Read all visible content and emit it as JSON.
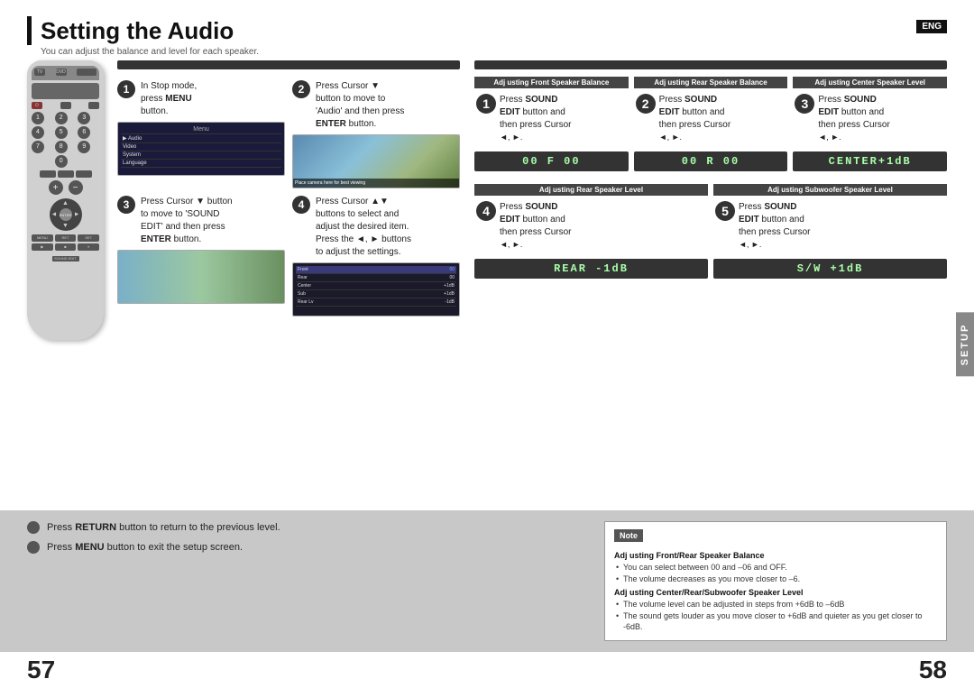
{
  "page": {
    "title": "Setting the Audio",
    "title_bar": "|",
    "subtitle": "You can adjust the balance and level for each speaker.",
    "eng_badge": "ENG",
    "page_num_left": "57",
    "page_num_right": "58",
    "setup_tab": "SETUP"
  },
  "left_steps": {
    "bar_label": "",
    "step1": {
      "num": "1",
      "text_line1": "In Stop mode,",
      "text_line2": "press ",
      "text_bold": "MENU",
      "text_line3": "button."
    },
    "step2": {
      "num": "2",
      "text_line1": "Press Cursor ▼",
      "text_line2": "button to move to",
      "text_line3": "'Audio' and then press",
      "text_bold": "ENTER",
      "text_line4": " button."
    },
    "step3": {
      "num": "3",
      "text_line1": "Press Cursor ▼ button",
      "text_line2": "to move to 'SOUND",
      "text_line3": "EDIT' and then press",
      "text_bold": "ENTER",
      "text_line4": " button."
    },
    "step4": {
      "num": "4",
      "text_line1": "Press Cursor ▲▼",
      "text_line2": "buttons to select and",
      "text_line3": "adjust the desired item.",
      "text_line4": "Press the ◄, ► buttons",
      "text_line5": "to adjust the settings."
    }
  },
  "right_sections": {
    "section1": {
      "label": "Adj usting Front Speaker Balance",
      "step1_text1": "Press ",
      "step1_bold1": "SOUND",
      "step1_text2": "",
      "step1_bold2": "EDIT",
      "step1_text3": " button and",
      "step1_text4": "then press Cursor",
      "step1_arrows": "◄, ►.",
      "display": "00 F  00"
    },
    "section2": {
      "label": "Adj usting Rear Speaker Balance",
      "step2_text1": "Press ",
      "step2_bold1": "SOUND",
      "step2_bold2": "EDIT",
      "step2_text2": " button and",
      "step2_text3": "then press Cursor",
      "step2_arrows": "◄, ►.",
      "display": "00 R  00"
    },
    "section3": {
      "label": "Adj usting Center Speaker Level",
      "step3_text1": "Press ",
      "step3_bold1": "SOUND",
      "step3_bold2": "EDIT",
      "step3_text2": " button and",
      "step3_text3": "then press Cursor",
      "step3_arrows": "◄, ►.",
      "display": "CENTER+1dB"
    },
    "section4": {
      "label": "Adj usting Rear Speaker Level",
      "step4_text1": "Press ",
      "step4_bold1": "SOUND",
      "step4_bold2": "EDIT",
      "step4_text2": " button and",
      "step4_text3": "then press Cursor",
      "step4_arrows": "◄, ►.",
      "display": "REAR  -1dB"
    },
    "section5": {
      "label": "Adj usting Subwoofer Speaker Level",
      "step5_text1": "Press ",
      "step5_bold1": "SOUND",
      "step5_bold2": "EDIT",
      "step5_text2": " button and",
      "step5_text3": "then press Cursor",
      "step5_arrows": "◄, ►.",
      "display": "S/W   +1dB"
    }
  },
  "bottom": {
    "instruction1_pre": "Press ",
    "instruction1_bold": "RETURN",
    "instruction1_post": " button to return to the previous level.",
    "instruction2_pre": "Press ",
    "instruction2_bold": "MENU",
    "instruction2_post": " button to exit the setup screen.",
    "note_header": "Note",
    "note_section1_title": "Adj usting Front/Rear Speaker Balance",
    "note_item1": "You can select between 00 and –06 and OFF.",
    "note_item2": "The volume decreases as you move closer to –6.",
    "note_section2_title": "Adj usting Center/Rear/Subwoofer Speaker Level",
    "note_item3": "The volume level can be adjusted in steps from +6dB to –6dB",
    "note_item4": "The sound gets louder as you move closer to +6dB and quieter as you get closer to -6dB."
  }
}
